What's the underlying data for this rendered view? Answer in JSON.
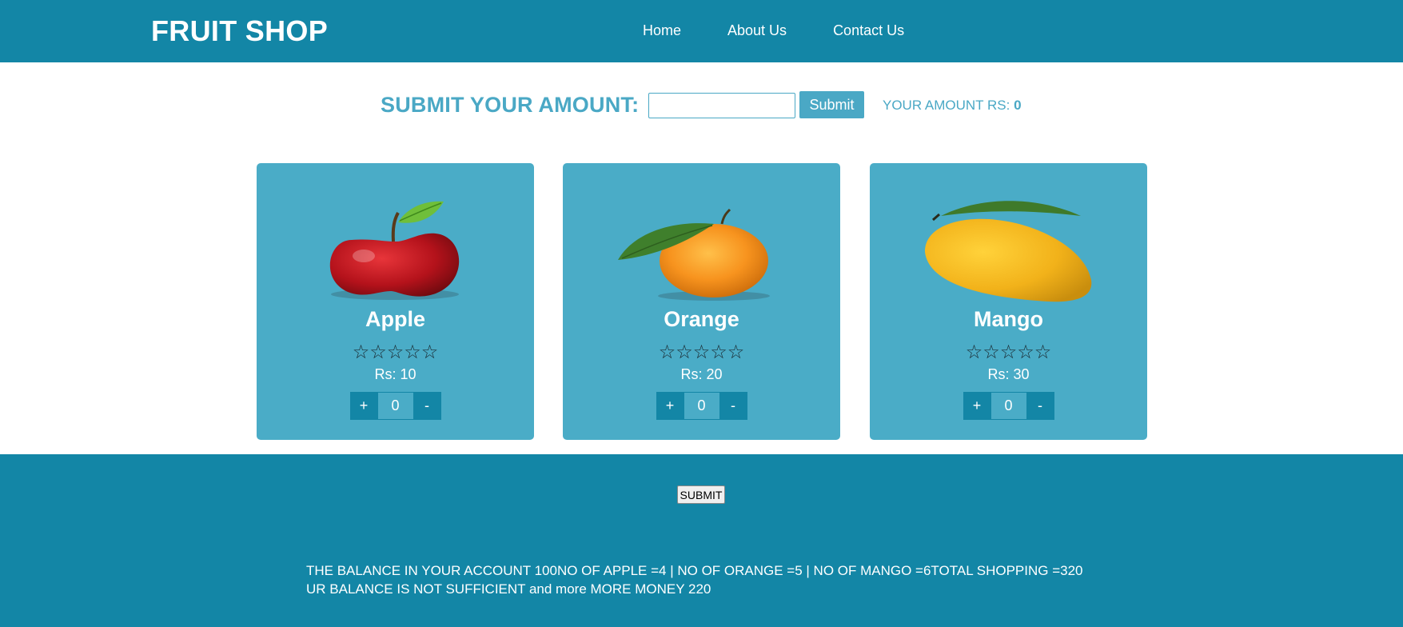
{
  "header": {
    "brand": "FRUIT SHOP",
    "nav": [
      "Home",
      "About Us",
      "Contact Us"
    ]
  },
  "amount": {
    "title": "SUBMIT YOUR AMOUNT:",
    "input_value": "",
    "submit_label": "Submit",
    "label_prefix": "YOUR AMOUNT RS:",
    "label_value": "0"
  },
  "products": [
    {
      "name": "Apple",
      "stars": "☆☆☆☆☆",
      "price": "Rs: 10",
      "plus": "+",
      "qty": "0",
      "minus": "-",
      "image": "apple"
    },
    {
      "name": "Orange",
      "stars": "☆☆☆☆☆",
      "price": "Rs: 20",
      "plus": "+",
      "qty": "0",
      "minus": "-",
      "image": "orange"
    },
    {
      "name": "Mango",
      "stars": "☆☆☆☆☆",
      "price": "Rs: 30",
      "plus": "+",
      "qty": "0",
      "minus": "-",
      "image": "mango"
    }
  ],
  "footer": {
    "submit_label": "SUBMIT",
    "line1": "THE BALANCE IN YOUR ACCOUNT 100NO OF APPLE =4 | NO OF ORANGE =5 | NO OF MANGO =6TOTAL SHOPPING =320",
    "line2": "UR BALANCE IS NOT SUFFICIENT and more MORE MONEY 220"
  },
  "colors": {
    "primary": "#1386a6",
    "card": "#4aacc7",
    "accent_text": "#4aa8c5"
  }
}
